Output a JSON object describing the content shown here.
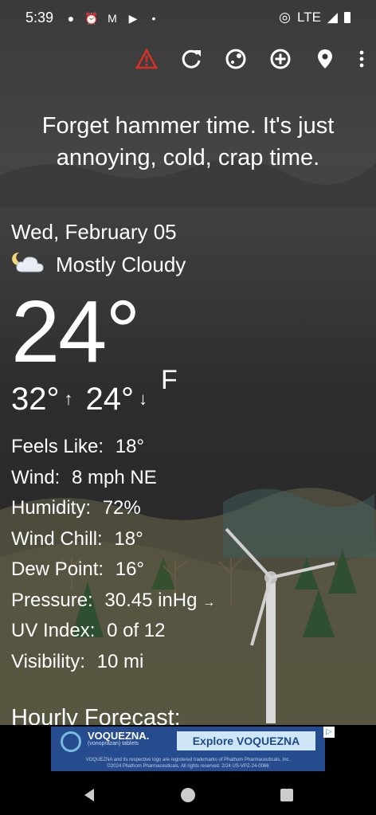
{
  "status_bar": {
    "time": "5:39",
    "left_icons": [
      "messenger-icon",
      "alarm-icon",
      "gmail-icon",
      "youtube-icon",
      "dot-icon"
    ],
    "network": "LTE"
  },
  "toolbar": {
    "icons": [
      "alert-icon",
      "refresh-icon",
      "theme-icon",
      "add-location-icon",
      "location-pin-icon",
      "more-vert-icon"
    ],
    "alert_color": "#d93025"
  },
  "headline": {
    "line1": "Forget hammer time. It's just",
    "line2": "annoying, cold, crap time."
  },
  "current": {
    "date": "Wed, February 05",
    "condition": "Mostly Cloudy",
    "condition_icon": "cloud-moon-icon",
    "temp": "24°",
    "unit": "F",
    "high": "32°",
    "high_arrow": "↑",
    "low": "24°",
    "low_arrow": "↓"
  },
  "details": [
    {
      "label": "Feels Like:",
      "value": "18°"
    },
    {
      "label": "Wind:",
      "value": "8 mph NE"
    },
    {
      "label": "Humidity:",
      "value": "72%"
    },
    {
      "label": "Wind Chill:",
      "value": "18°"
    },
    {
      "label": "Dew Point:",
      "value": "16°"
    },
    {
      "label": "Pressure:",
      "value": "30.45 inHg",
      "trend": "→"
    },
    {
      "label": "UV Index:",
      "value": "0 of 12"
    },
    {
      "label": "Visibility:",
      "value": "10 mi"
    }
  ],
  "hourly_title": "Hourly Forecast:",
  "ad": {
    "brand": "VOQUEZNA.",
    "sub": "(vonoprazan) tablets",
    "cta": "Explore VOQUEZNA",
    "fine_print_1": "VOQUEZNA and its respective logo are registered trademarks of Phathom Pharmaceuticals, Inc.",
    "fine_print_2": "©2024 Phathom Pharmaceuticals. All rights reserved. 2/24 US-VPZ-24-0066",
    "info_icon": "ad-choices-icon"
  },
  "nav": [
    "back-icon",
    "home-icon",
    "recents-icon"
  ]
}
